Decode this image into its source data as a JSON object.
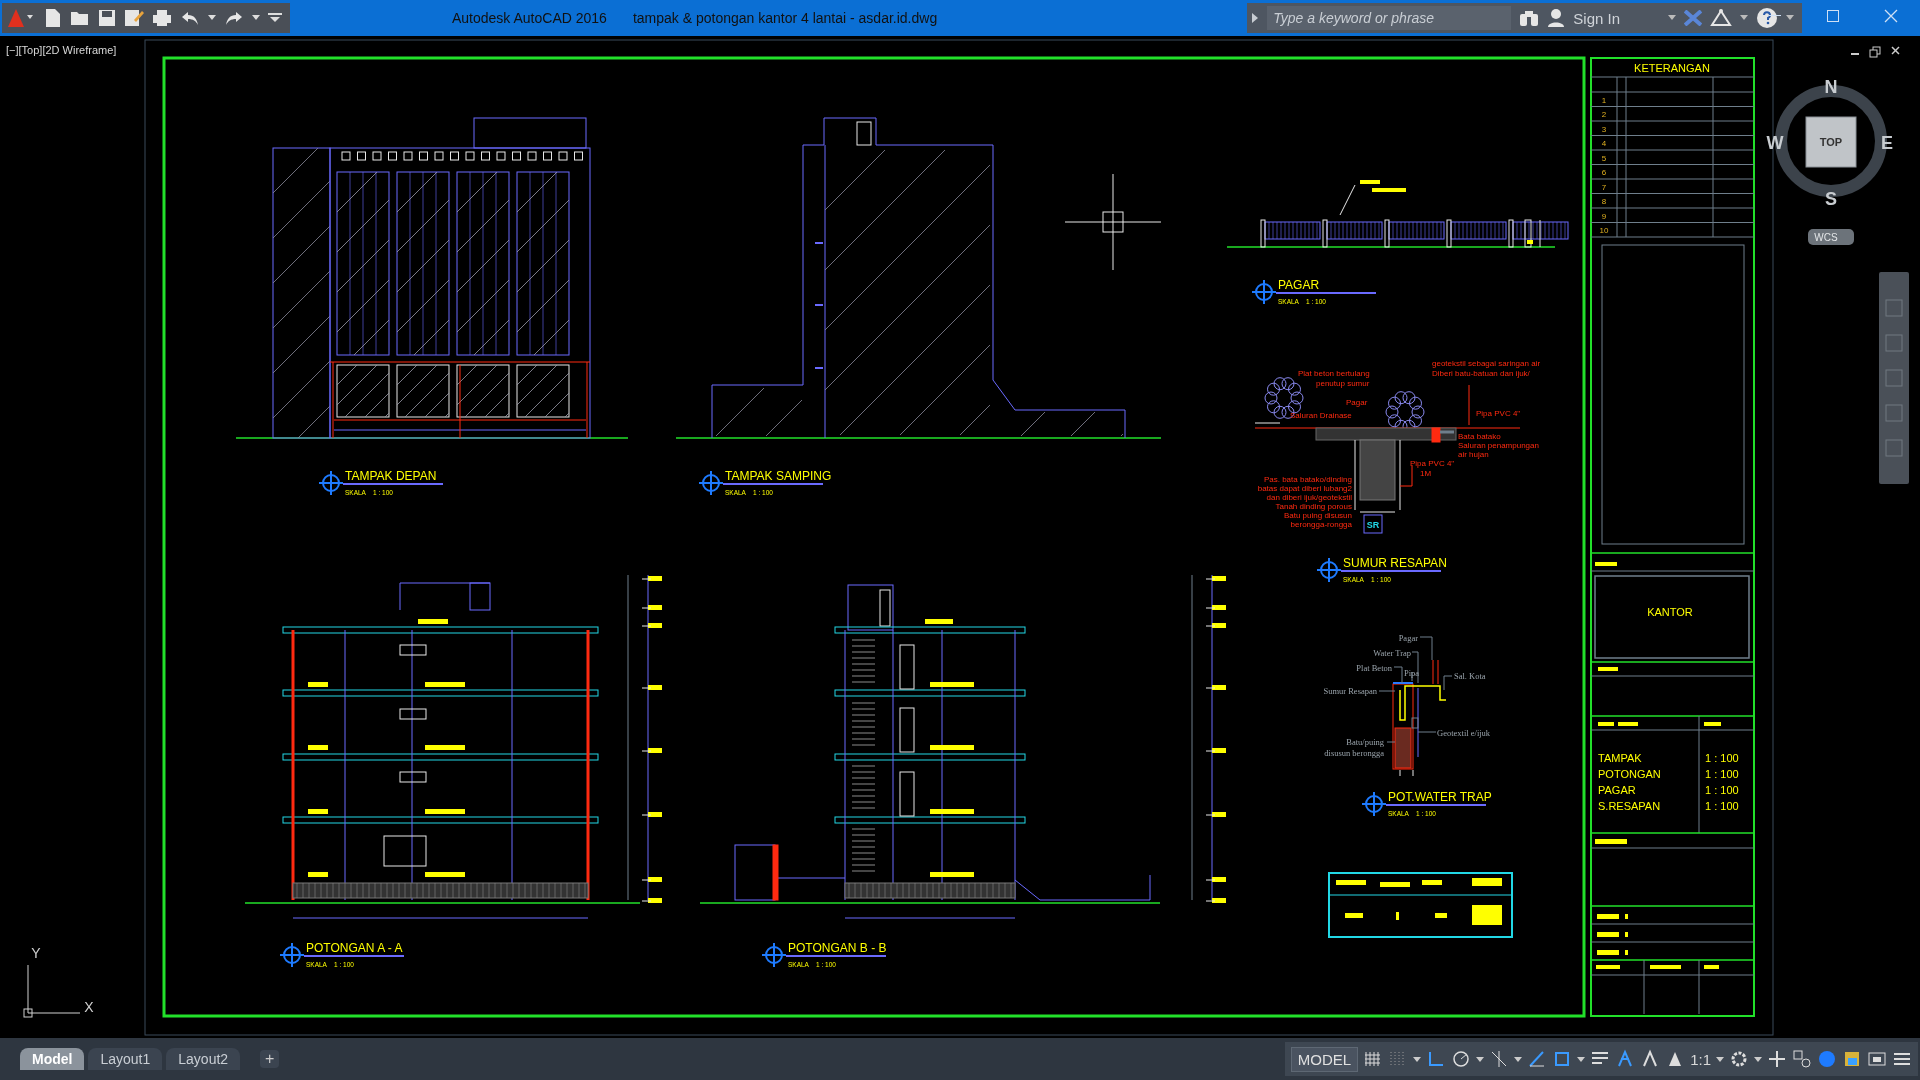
{
  "window": {
    "app_title": "Autodesk AutoCAD 2016",
    "file_title": "tampak & potongan kantor 4 lantai - asdar.id.dwg"
  },
  "search": {
    "placeholder": "Type a keyword or phrase"
  },
  "account": {
    "sign_in": "Sign In"
  },
  "viewport": {
    "label": "[−][Top][2D Wireframe]"
  },
  "view_cube": {
    "north": "N",
    "east": "E",
    "south": "S",
    "west": "W",
    "face": "TOP",
    "coordinate_system": "WCS"
  },
  "ucs_icon": {
    "x_axis": "X",
    "y_axis": "Y"
  },
  "drawings": [
    {
      "kind": "front-elevation",
      "title": "TAMPAK DEPAN",
      "scale_label": "SKALA",
      "scale": "1 : 100"
    },
    {
      "kind": "side-elevation",
      "title": "TAMPAK SAMPING",
      "scale_label": "SKALA",
      "scale": "1 : 100"
    },
    {
      "kind": "fence",
      "title": "PAGAR",
      "scale_label": "SKALA",
      "scale": "1 : 100"
    },
    {
      "kind": "infiltration-well",
      "title": "SUMUR RESAPAN",
      "scale_label": "SKALA",
      "scale": "1 : 100",
      "marker": "SR",
      "notes": [
        "Plat beton bertulang",
        "penutup sumur",
        "Pagar",
        "Saluran Drainase",
        "geotekstil sebagai saringan air",
        "Diberi batu-batuan dan ijuk/",
        "Pipa PVC 4\"",
        "Bata batako",
        "Saluran penampungan",
        "air hujan",
        "Pipa PVC 4\"",
        "1M",
        "Pas. bata batako/dinding",
        "batas dapat diberi lubang2",
        "dan diberi ijuk/geotekstil",
        "Tanah dinding porous",
        "Batu puing disusun",
        "berongga-rongga"
      ]
    },
    {
      "kind": "section-a",
      "title": "POTONGAN A - A",
      "scale_label": "SKALA",
      "scale": "1 : 100"
    },
    {
      "kind": "section-b",
      "title": "POTONGAN B - B",
      "scale_label": "SKALA",
      "scale": "1 : 100"
    },
    {
      "kind": "water-trap",
      "title": "POT.WATER TRAP",
      "scale_label": "SKALA",
      "scale": "1 : 100",
      "notes": [
        "Pagar",
        "Water Trap",
        "Plat Beton",
        "Pipa",
        "Sal. Kota",
        "Sumur Resapan",
        "Geotextil e/ijuk",
        "Batu/puing",
        "disusun berongga"
      ]
    }
  ],
  "title_block": {
    "header": "KETERANGAN",
    "row_numbers": [
      "1",
      "2",
      "3",
      "4",
      "5",
      "6",
      "7",
      "8",
      "9",
      "10"
    ],
    "project": "KANTOR",
    "scales": [
      {
        "drawing": "TAMPAK",
        "scale": "1 : 100"
      },
      {
        "drawing": "POTONGAN",
        "scale": "1 : 100"
      },
      {
        "drawing": "PAGAR",
        "scale": "1 : 100"
      },
      {
        "drawing": "S.RESAPAN",
        "scale": "1 : 100"
      }
    ]
  },
  "layout_tabs": [
    {
      "label": "Model",
      "selected": true
    },
    {
      "label": "Layout1",
      "selected": false
    },
    {
      "label": "Layout2",
      "selected": false
    }
  ],
  "new_tab": "+",
  "status_bar": {
    "space": "MODEL",
    "annotation_scale": "1:1"
  }
}
